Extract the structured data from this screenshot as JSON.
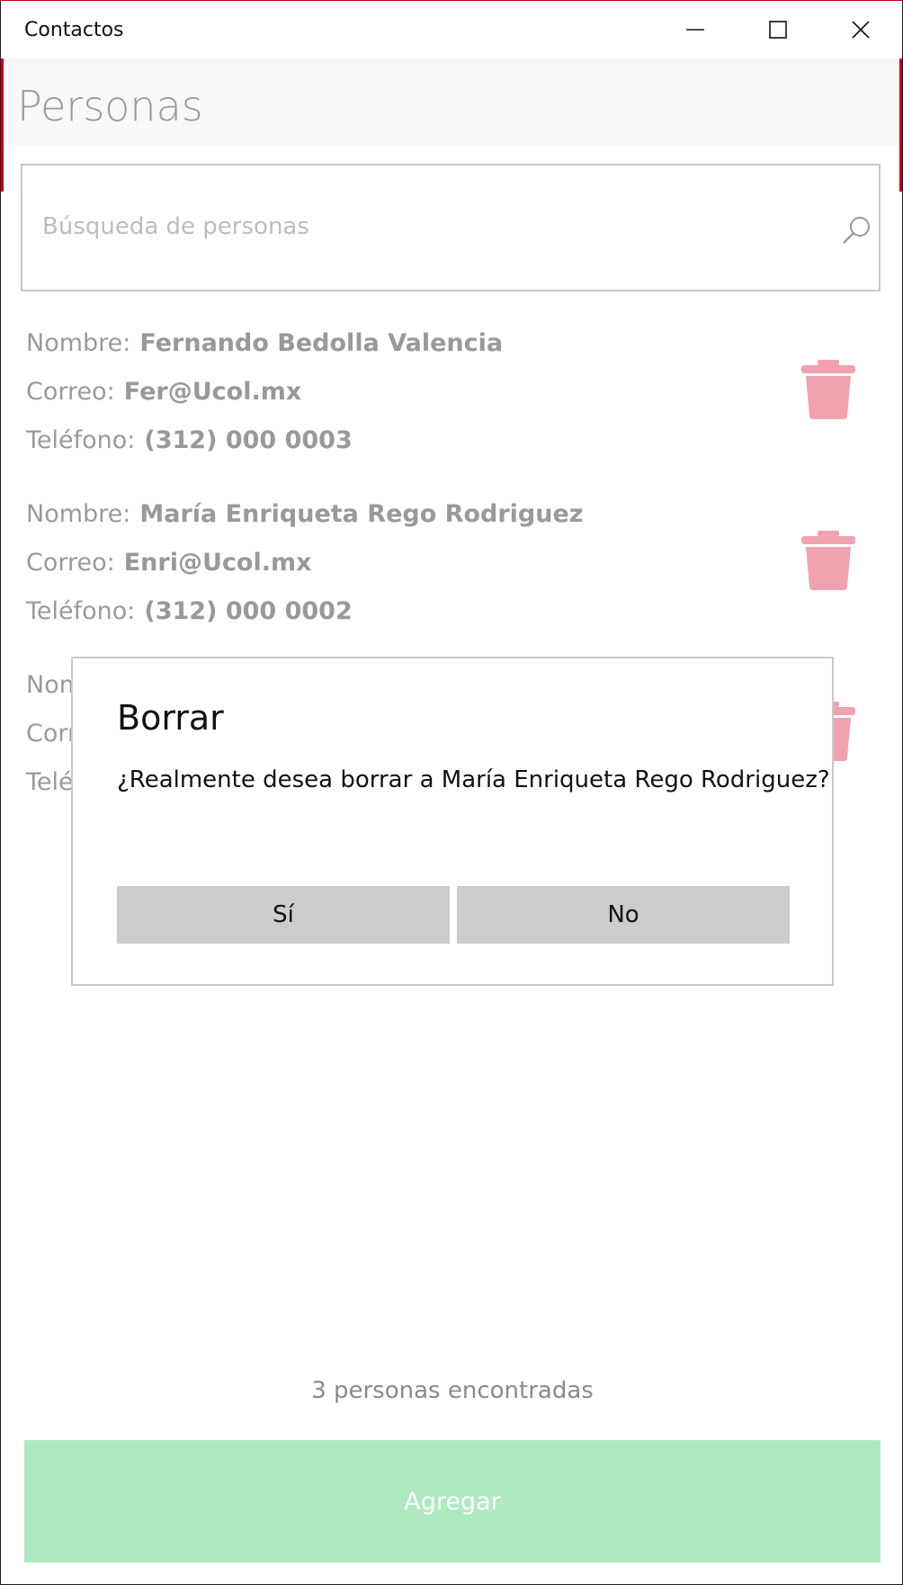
{
  "window": {
    "title": "Contactos"
  },
  "header": {
    "title": "Personas"
  },
  "search": {
    "placeholder": "Búsqueda de personas",
    "value": ""
  },
  "labels": {
    "name": "Nombre:",
    "email": "Correo:",
    "phone": "Teléfono:"
  },
  "contacts": [
    {
      "name": "Fernando Bedolla Valencia",
      "email": "Fer@Ucol.mx",
      "phone": "(312) 000 0003"
    },
    {
      "name": "María Enriqueta Rego Rodriguez",
      "email": "Enri@Ucol.mx",
      "phone": "(312) 000 0002"
    },
    {
      "name": "",
      "email": "",
      "phone": ""
    }
  ],
  "dialog": {
    "title": "Borrar",
    "message": "¿Realmente desea borrar a María Enriqueta Rego Rodriguez?",
    "yes_label": "Sí",
    "no_label": "No"
  },
  "footer": {
    "count_text": "3 personas encontradas",
    "add_label": "Agregar"
  },
  "colors": {
    "accent": "#c4001a",
    "trash": "#f2a1b0",
    "add_button": "#aee9c0",
    "dialog_button": "#cccccc"
  }
}
